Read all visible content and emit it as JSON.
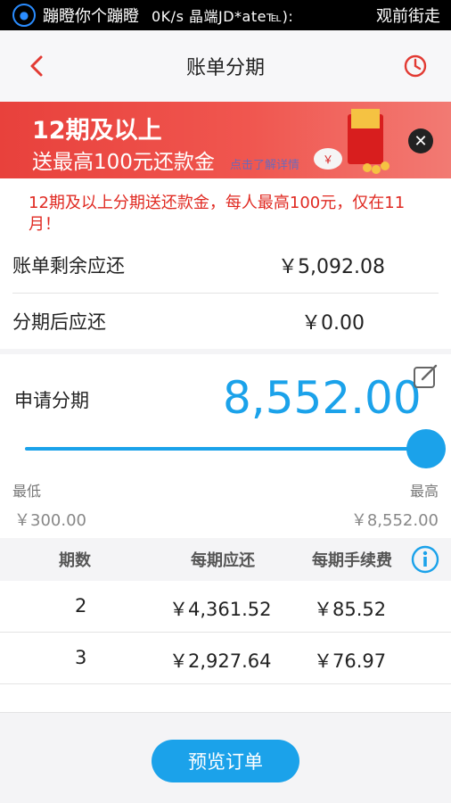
{
  "status_bar": {
    "left_text": "蹦瞪你个蹦瞪",
    "mid_text": "0K/s 晶端JD*ate℡):",
    "right_text": "观前街走"
  },
  "nav": {
    "title": "账单分期",
    "back_icon": "chevron-left-icon",
    "history_icon": "clock-icon"
  },
  "banner": {
    "line1": "12期及以上",
    "line2": "送最高100元还款金",
    "link": "点击了解详情"
  },
  "notice": "12期及以上分期送还款金，每人最高100元，仅在11月！",
  "bill": {
    "remaining_label": "账单剩余应还",
    "remaining_value": "￥5,092.08",
    "after_label": "分期后应还",
    "after_value": "￥0.00"
  },
  "apply": {
    "label": "申请分期",
    "amount": "8,552.00",
    "min_label": "最低",
    "max_label": "最高",
    "min_value": "￥300.00",
    "max_value": "￥8,552.00",
    "slider_fraction": 1.0
  },
  "table": {
    "headers": [
      "期数",
      "每期应还",
      "每期手续费"
    ],
    "rows": [
      {
        "periods": "2",
        "per_period": "￥4,361.52",
        "fee": "￥85.52"
      },
      {
        "periods": "3",
        "per_period": "￥2,927.64",
        "fee": "￥76.97"
      }
    ]
  },
  "footer": {
    "button_label": "预览订单"
  },
  "colors": {
    "accent": "#1ba2ea",
    "alert": "#e02a22",
    "banner": "#e8413c"
  }
}
